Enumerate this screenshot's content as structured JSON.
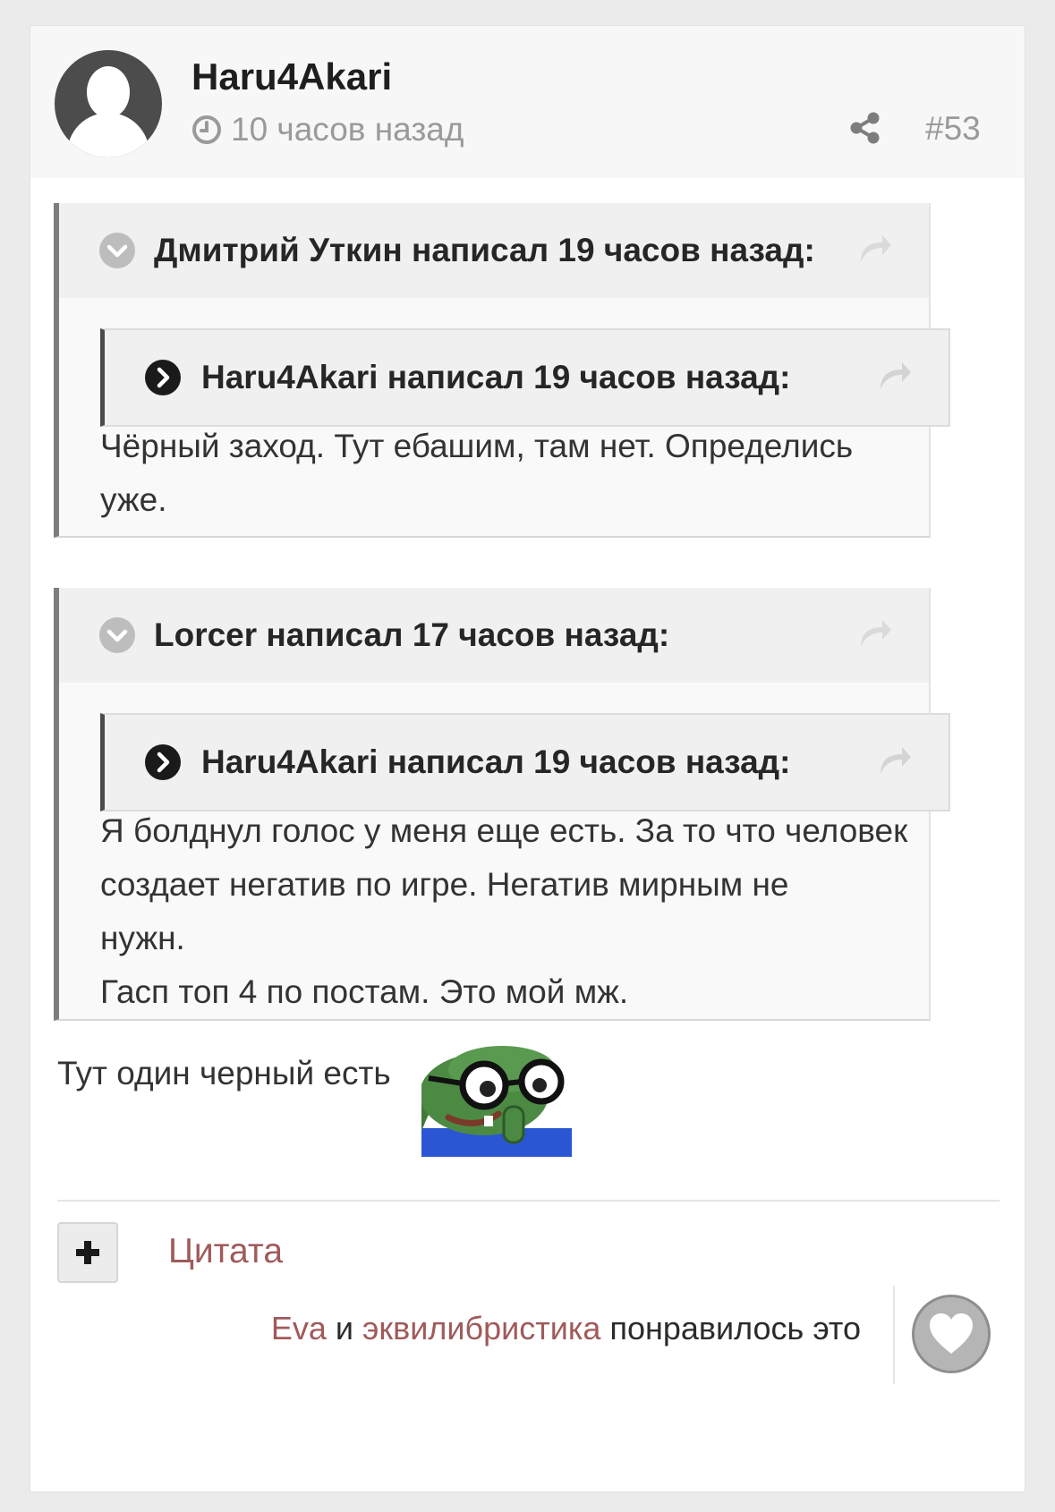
{
  "post": {
    "author": "Haru4Akari",
    "time": "10 часов назад",
    "number": "#53",
    "icons": {
      "avatar": "default-user-avatar",
      "time": "clock-icon",
      "share": "share-icon"
    }
  },
  "quotes": [
    {
      "citation": "Дмитрий Уткин написал 19 часов назад:",
      "inner_citation": "Haru4Akari написал 19 часов назад:",
      "lines": [
        "Чёрный заход. Тут ебашим, там нет. Определись",
        "уже."
      ]
    },
    {
      "citation": "Lorcer написал 17 часов назад:",
      "inner_citation": "Haru4Akari написал 19 часов назад:",
      "lines": [
        "Я болднул голос у меня еще есть. За то что человек",
        "создает негатив по игре. Негатив мирным не",
        "нужн.",
        "Гасп топ 4 по постам. Это мой мж."
      ]
    }
  ],
  "reply": {
    "text": "Тут один черный есть",
    "emoji": "pepe-glasses-emoji"
  },
  "actions": {
    "quote_button_icon": "plus-icon",
    "quote_label": "Цитата"
  },
  "likes": {
    "user1": "Eva",
    "and": "и",
    "user2": "эквилибристика",
    "suffix": "понравилось это",
    "icon": "heart-icon"
  },
  "colors": {
    "link": "#a05a5a",
    "muted": "#9a9a9a",
    "quote_border": "#7d7d7d"
  }
}
